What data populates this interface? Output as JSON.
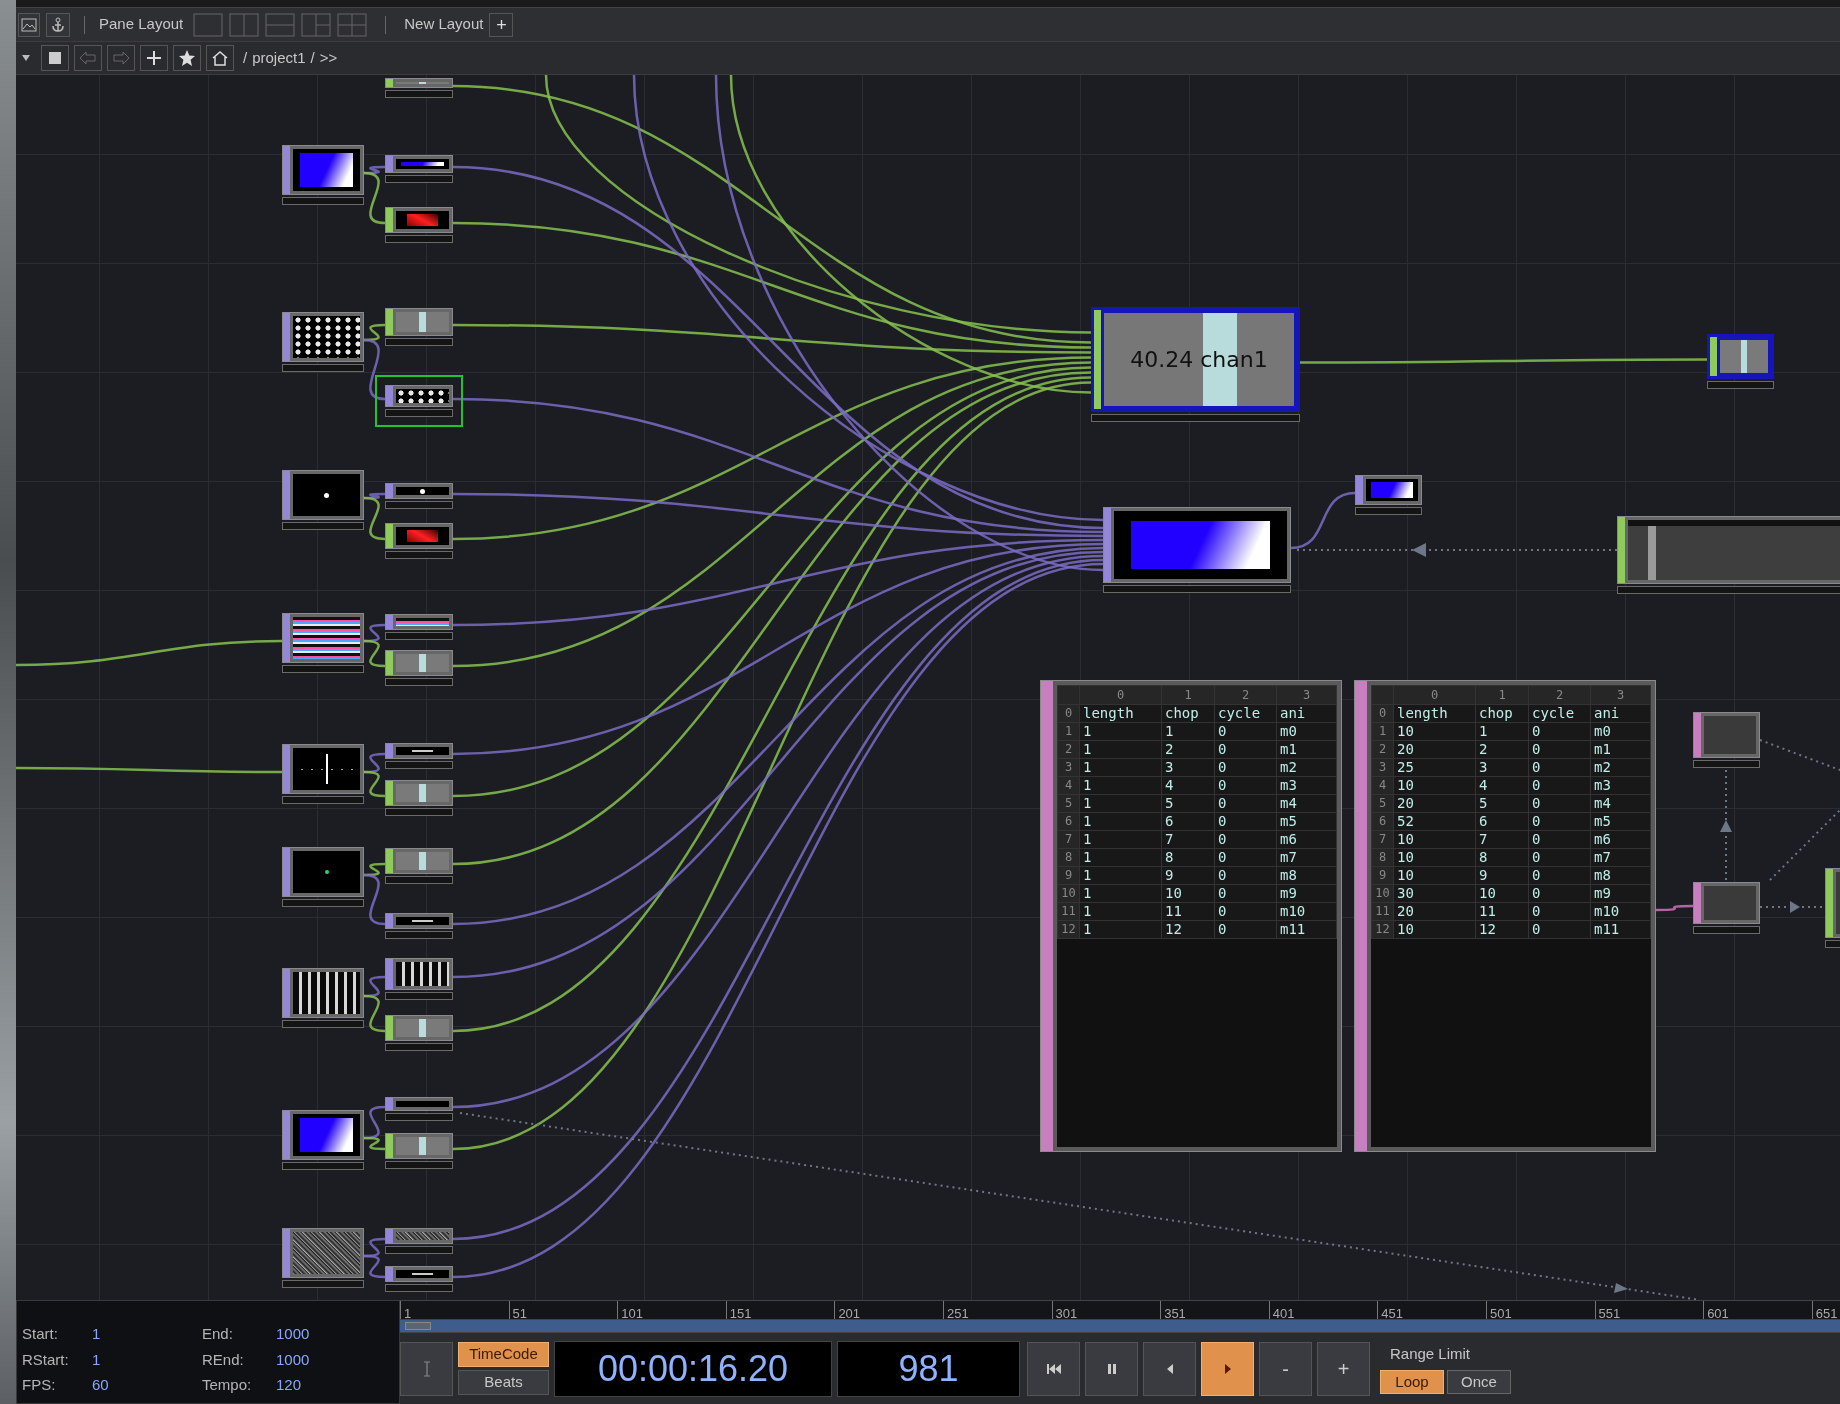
{
  "toolbar": {
    "pane_layout_label": "Pane Layout",
    "new_layout_label": "New Layout",
    "add_layout_button": "+"
  },
  "path_bar": {
    "segments": [
      "/",
      "project1",
      "/",
      ">>"
    ]
  },
  "network": {
    "nodes": [
      {
        "kind": "top",
        "selected": false
      },
      {
        "kind": "top",
        "selected": false
      },
      {
        "kind": "top",
        "selected": false
      },
      {
        "kind": "top",
        "selected": false
      },
      {
        "kind": "top",
        "selected": false
      },
      {
        "kind": "top",
        "selected": false
      },
      {
        "kind": "top",
        "selected": false
      },
      {
        "kind": "top",
        "selected": false
      },
      {
        "kind": "top",
        "selected": false
      },
      {
        "kind": "chop",
        "selected": false
      },
      {
        "kind": "top",
        "selected": false
      },
      {
        "kind": "chop",
        "selected": false
      },
      {
        "kind": "chop",
        "selected": false
      },
      {
        "kind": "top",
        "selected": true
      },
      {
        "kind": "top",
        "selected": false
      },
      {
        "kind": "chop",
        "selected": false
      },
      {
        "kind": "top",
        "selected": false
      },
      {
        "kind": "chop",
        "selected": false
      },
      {
        "kind": "top",
        "selected": false
      },
      {
        "kind": "chop",
        "selected": false
      },
      {
        "kind": "chop",
        "selected": false
      },
      {
        "kind": "top",
        "selected": false
      },
      {
        "kind": "top",
        "selected": false
      },
      {
        "kind": "chop",
        "selected": false
      },
      {
        "kind": "top",
        "selected": false
      },
      {
        "kind": "chop",
        "selected": false
      },
      {
        "kind": "top",
        "selected": false
      },
      {
        "kind": "top",
        "selected": false
      },
      {
        "kind": "chop",
        "selected": false,
        "viewer_text": "40.24 chan1"
      },
      {
        "kind": "top",
        "selected": false
      },
      {
        "kind": "top",
        "selected": false
      },
      {
        "kind": "chop",
        "selected": false
      },
      {
        "kind": "chop",
        "selected": false
      },
      {
        "kind": "dat",
        "selected": false
      },
      {
        "kind": "dat",
        "selected": false
      },
      {
        "kind": "chop",
        "selected": false
      }
    ],
    "tables": [
      {
        "columns": [
          "0",
          "1",
          "2",
          "3"
        ],
        "rows": [
          {
            "index": "0",
            "cells": [
              "length",
              "chop",
              "cycle",
              "ani"
            ]
          },
          {
            "index": "1",
            "cells": [
              "1",
              "1",
              "0",
              "m0"
            ]
          },
          {
            "index": "2",
            "cells": [
              "1",
              "2",
              "0",
              "m1"
            ]
          },
          {
            "index": "3",
            "cells": [
              "1",
              "3",
              "0",
              "m2"
            ]
          },
          {
            "index": "4",
            "cells": [
              "1",
              "4",
              "0",
              "m3"
            ]
          },
          {
            "index": "5",
            "cells": [
              "1",
              "5",
              "0",
              "m4"
            ]
          },
          {
            "index": "6",
            "cells": [
              "1",
              "6",
              "0",
              "m5"
            ]
          },
          {
            "index": "7",
            "cells": [
              "1",
              "7",
              "0",
              "m6"
            ]
          },
          {
            "index": "8",
            "cells": [
              "1",
              "8",
              "0",
              "m7"
            ]
          },
          {
            "index": "9",
            "cells": [
              "1",
              "9",
              "0",
              "m8"
            ]
          },
          {
            "index": "10",
            "cells": [
              "1",
              "10",
              "0",
              "m9"
            ]
          },
          {
            "index": "11",
            "cells": [
              "1",
              "11",
              "0",
              "m10"
            ]
          },
          {
            "index": "12",
            "cells": [
              "1",
              "12",
              "0",
              "m11"
            ]
          }
        ]
      },
      {
        "columns": [
          "0",
          "1",
          "2",
          "3"
        ],
        "rows": [
          {
            "index": "0",
            "cells": [
              "length",
              "chop",
              "cycle",
              "ani"
            ]
          },
          {
            "index": "1",
            "cells": [
              "10",
              "1",
              "0",
              "m0"
            ]
          },
          {
            "index": "2",
            "cells": [
              "20",
              "2",
              "0",
              "m1"
            ]
          },
          {
            "index": "3",
            "cells": [
              "25",
              "3",
              "0",
              "m2"
            ]
          },
          {
            "index": "4",
            "cells": [
              "10",
              "4",
              "0",
              "m3"
            ]
          },
          {
            "index": "5",
            "cells": [
              "20",
              "5",
              "0",
              "m4"
            ]
          },
          {
            "index": "6",
            "cells": [
              "52",
              "6",
              "0",
              "m5"
            ]
          },
          {
            "index": "7",
            "cells": [
              "10",
              "7",
              "0",
              "m6"
            ]
          },
          {
            "index": "8",
            "cells": [
              "10",
              "8",
              "0",
              "m7"
            ]
          },
          {
            "index": "9",
            "cells": [
              "10",
              "9",
              "0",
              "m8"
            ]
          },
          {
            "index": "10",
            "cells": [
              "30",
              "10",
              "0",
              "m9"
            ]
          },
          {
            "index": "11",
            "cells": [
              "20",
              "11",
              "0",
              "m10"
            ]
          },
          {
            "index": "12",
            "cells": [
              "10",
              "12",
              "0",
              "m11"
            ]
          }
        ]
      }
    ]
  },
  "timeline": {
    "ruler": [
      "1",
      "51",
      "101",
      "151",
      "201",
      "251",
      "301",
      "351",
      "401",
      "451",
      "501",
      "551",
      "601",
      "651"
    ]
  },
  "range_panel": {
    "fields": [
      {
        "label": "Start:",
        "value": "1"
      },
      {
        "label": "End:",
        "value": "1000"
      },
      {
        "label": "RStart:",
        "value": "1"
      },
      {
        "label": "REnd:",
        "value": "1000"
      },
      {
        "label": "FPS:",
        "value": "60"
      },
      {
        "label": "Tempo:",
        "value": "120"
      }
    ]
  },
  "transport": {
    "time_modes": [
      {
        "label": "TimeCode",
        "selected": true
      },
      {
        "label": "Beats",
        "selected": false
      }
    ],
    "timecode": "00:00:16.20",
    "frame": "981",
    "buttons": [
      {
        "kind": "rewind",
        "selected": false
      },
      {
        "kind": "pause",
        "selected": false
      },
      {
        "kind": "step-back",
        "selected": false
      },
      {
        "kind": "play",
        "selected": true
      },
      {
        "kind": "text",
        "label": "-",
        "selected": false
      },
      {
        "kind": "text",
        "label": "+",
        "selected": false
      }
    ],
    "range_limit_label": "Range Limit",
    "range_modes": [
      {
        "label": "Loop",
        "selected": true
      },
      {
        "label": "Once",
        "selected": false
      }
    ]
  }
}
